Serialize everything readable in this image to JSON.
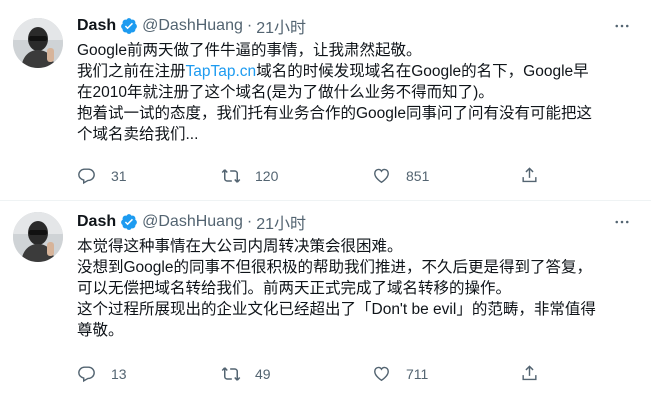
{
  "tweets": [
    {
      "author_name": "Dash",
      "handle": "@DashHuang",
      "separator": "·",
      "time": "21小时",
      "text_lines": [
        {
          "before": "Google前两天做了件牛逼的事情，让我肃然起敬。",
          "link": "",
          "after": ""
        },
        {
          "before": "我们之前在注册",
          "link": "TapTap.cn",
          "after": "域名的时候发现域名在Google的名下，Google早"
        },
        {
          "before": "在2010年就注册了这个域名(是为了做什么业务不得而知了)。",
          "link": "",
          "after": ""
        },
        {
          "before": "抱着试一试的态度，我们托有业务合作的Google同事问了问有没有可能把这",
          "link": "",
          "after": ""
        },
        {
          "before": "个域名卖给我们...",
          "link": "",
          "after": ""
        }
      ],
      "replies": "31",
      "retweets": "120",
      "likes": "851"
    },
    {
      "author_name": "Dash",
      "handle": "@DashHuang",
      "separator": "·",
      "time": "21小时",
      "text_lines": [
        {
          "before": "本觉得这种事情在大公司内周转决策会很困难。",
          "link": "",
          "after": ""
        },
        {
          "before": "没想到Google的同事不但很积极的帮助我们推进，不久后更是得到了答复，",
          "link": "",
          "after": ""
        },
        {
          "before": "可以无偿把域名转给我们。前两天正式完成了域名转移的操作。",
          "link": "",
          "after": ""
        },
        {
          "before": "这个过程所展现出的企业文化已经超出了「Don't be evil」的范畴，非常值得",
          "link": "",
          "after": ""
        },
        {
          "before": "尊敬。",
          "link": "",
          "after": ""
        }
      ],
      "replies": "13",
      "retweets": "49",
      "likes": "711"
    }
  ],
  "icons": {
    "more": "more-horizontal-icon",
    "verified": "verified-badge-icon",
    "reply": "reply-icon",
    "retweet": "retweet-icon",
    "like": "heart-icon",
    "share": "share-icon"
  },
  "colors": {
    "text": "#0f1419",
    "secondary": "#536471",
    "link": "#1d9bf0",
    "verified": "#1d9bf0",
    "divider": "#eff3f4"
  }
}
